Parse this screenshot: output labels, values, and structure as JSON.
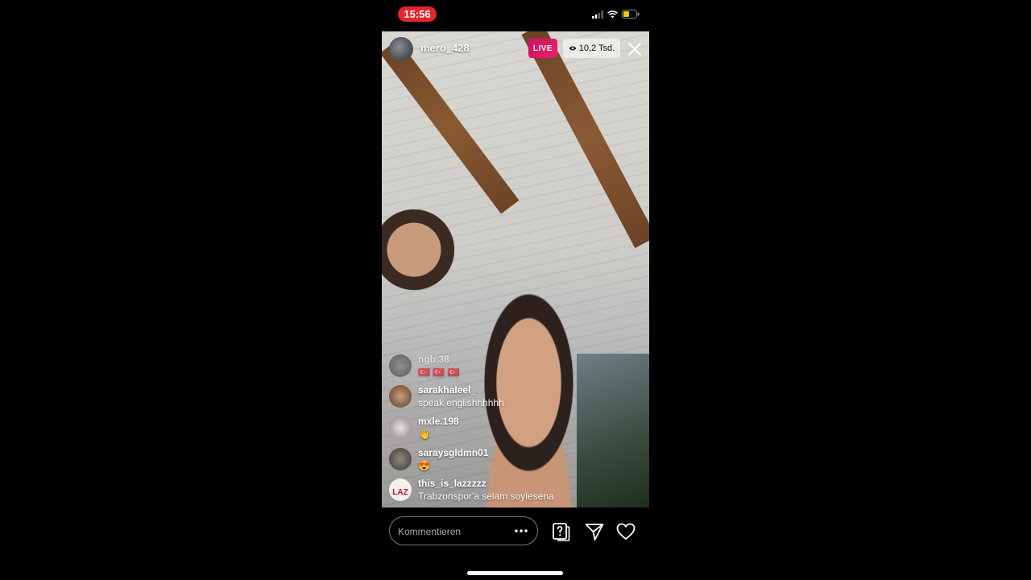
{
  "status_bar": {
    "time": "15:56"
  },
  "live": {
    "host_username": "mero_428",
    "live_label": "LIVE",
    "viewer_count": "10,2 Tsd."
  },
  "comments": [
    {
      "username": "ngb.38",
      "text": "🇹🇷 🇹🇷 🇹🇷"
    },
    {
      "username": "sarakhaleel_",
      "text": "speak englishhhhhh"
    },
    {
      "username": "mxle.198",
      "text": "👋"
    },
    {
      "username": "saraysgldmn01",
      "text": "😍"
    },
    {
      "username": "this_is_lazzzzz",
      "text": "Trabzonspor'a selam soylesena"
    }
  ],
  "comment_avatar_labels": {
    "lazzz_logo": "LAZ"
  },
  "composer": {
    "placeholder": "Kommentieren"
  },
  "colors": {
    "live_pink": "#d3105f",
    "clock_red": "#e0262b"
  },
  "icons": [
    "signal-icon",
    "wifi-icon",
    "battery-icon",
    "eye-icon",
    "close-icon",
    "more-icon",
    "question-icon",
    "send-icon",
    "heart-icon"
  ]
}
